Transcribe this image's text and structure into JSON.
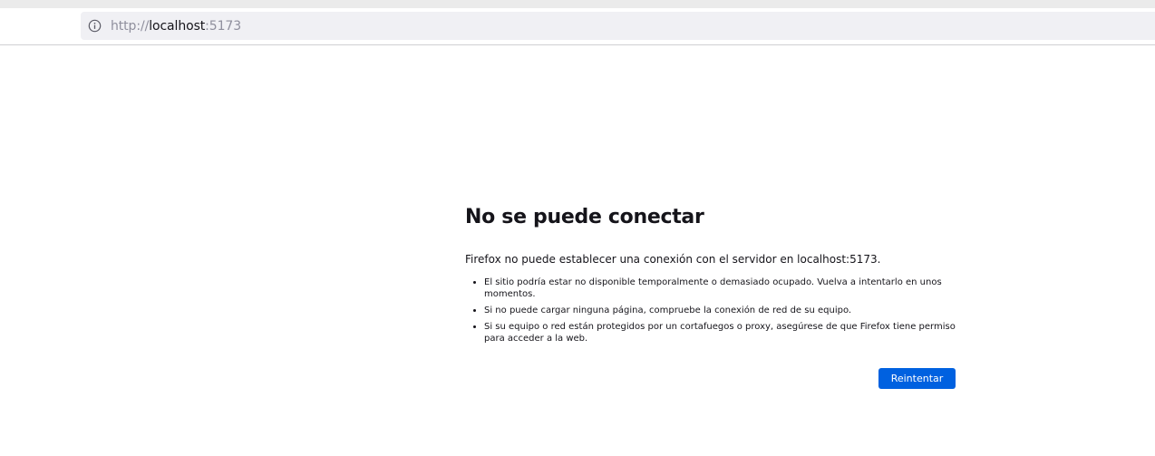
{
  "browser": {
    "url_prefix": "http://",
    "url_host": "localhost",
    "url_port": ":5173"
  },
  "error": {
    "title": "No se puede conectar",
    "description": "Firefox no puede establecer una conexión con el servidor en localhost:5173.",
    "items": [
      "El sitio podría estar no disponible temporalmente o demasiado ocupado. Vuelva a intentarlo en unos momentos.",
      "Si no puede cargar ninguna página, compruebe la conexión de red de su equipo.",
      "Si su equipo o red están protegidos por un cortafuegos o proxy, asegúrese de que Firefox tiene permiso para acceder a la web."
    ],
    "retry_label": "Reintentar"
  }
}
